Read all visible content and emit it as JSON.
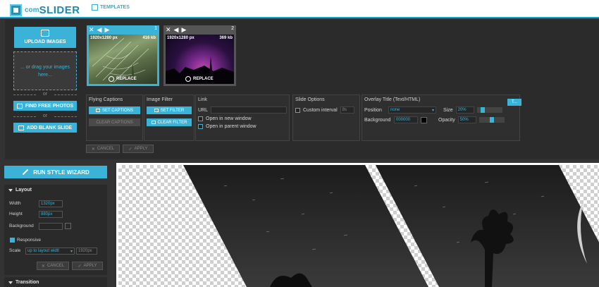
{
  "header": {
    "logo_com": "com",
    "logo_slider": "SLIDER",
    "templates_label": "TEMPLATES"
  },
  "upload": {
    "upload_label": "UPLOAD IMAGES",
    "drop_text": "... or drag your images here...",
    "or1": "or",
    "find_photos_label": "FIND FREE PHOTOS",
    "or2": "or",
    "add_blank_label": "ADD BLANK SLIDE"
  },
  "thumbnails": [
    {
      "number": "1",
      "dimensions": "1920x1280 px",
      "size": "416 kb",
      "replace": "REPLACE"
    },
    {
      "number": "2",
      "dimensions": "1920x1280 px",
      "size": "369 kb",
      "replace": "REPLACE"
    }
  ],
  "flying_captions": {
    "title": "Flying Captions",
    "set_label": "SET CAPTIONS",
    "clear_label": "CLEAR CAPTIONS"
  },
  "image_filter": {
    "title": "Image Filter",
    "set_label": "SET FILTER",
    "clear_label": "CLEAR FILTER"
  },
  "link": {
    "title": "Link",
    "url_label": "URL",
    "url_value": "",
    "new_window_label": "Open in new window",
    "parent_window_label": "Open in parent window"
  },
  "slide_options": {
    "title": "Slide Options",
    "custom_interval_label": "Custom interval",
    "interval_value": "8s"
  },
  "overlay_title": {
    "title": "Overlay Title (Text/HTML)",
    "position_label": "Position",
    "position_value": "none",
    "size_label": "Size",
    "size_value": "20%",
    "size_level": 0.15,
    "background_label": "Background",
    "background_value": "000000",
    "opacity_label": "Opacity",
    "opacity_value": "50%",
    "opacity_level": 0.5,
    "edit_label": "..."
  },
  "actions": {
    "cancel_label": "CANCEL",
    "apply_label": "APPLY"
  },
  "wizard": {
    "label": "RUN STYLE WIZARD"
  },
  "layout": {
    "title": "Layout",
    "width_label": "Width",
    "width_value": "1320px",
    "height_label": "Height",
    "height_value": "880px",
    "background_label": "Background",
    "background_value": "",
    "responsive_label": "Responsive",
    "responsive_checked": true,
    "scale_label": "Scale",
    "scale_value": "up to layout widtl",
    "scale_px": "1920px",
    "cancel_label": "CANCEL",
    "apply_label": "APPLY"
  },
  "transition": {
    "title": "Transition"
  },
  "colors": {
    "accent": "#3bb3d8",
    "panel_bg": "#2b2b2b",
    "header_line": "#13a3c8"
  }
}
